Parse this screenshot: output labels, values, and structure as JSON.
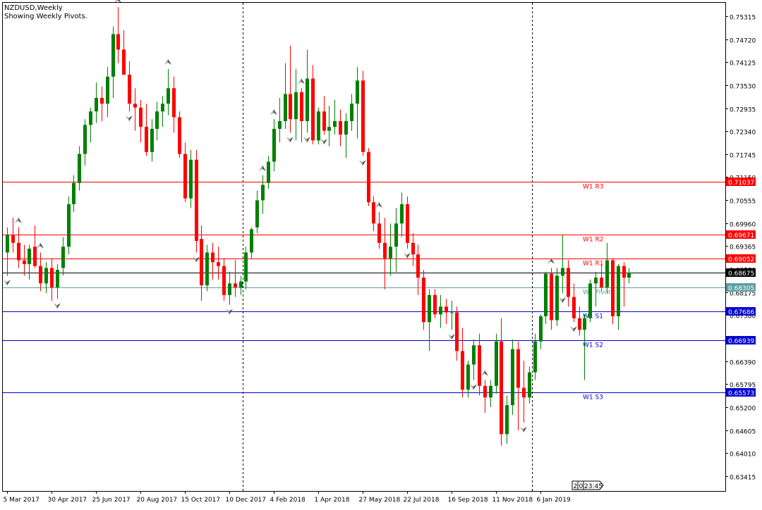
{
  "header": {
    "symbol_line": "NZDUSD,Weekly",
    "subtitle": "Showing Weekly Pivots."
  },
  "timer": {
    "d1": "2",
    "d2": "0",
    "time": "23:45"
  },
  "colors": {
    "bull": "#008000",
    "bear": "#ff0000",
    "grid_border": "#000000",
    "resistance": "#ff0000",
    "support": "#0000cd",
    "pivot": "#5f9ea0",
    "current": "#000000"
  },
  "chart_data": {
    "type": "candlestick",
    "title": "NZDUSD,Weekly",
    "subtitle": "Showing Weekly Pivots.",
    "y_axis": {
      "ticks": [
        "0.75315",
        "0.74720",
        "0.74125",
        "0.73530",
        "0.72935",
        "0.72340",
        "0.71745",
        "0.71150",
        "0.70555",
        "0.69960",
        "0.69365",
        "0.68770",
        "0.68175",
        "0.67580",
        "0.66985",
        "0.66390",
        "0.65795",
        "0.65200",
        "0.64605",
        "0.64010",
        "0.63415"
      ],
      "ylim": [
        0.6303,
        0.7566
      ]
    },
    "x_axis": {
      "labels": [
        {
          "text": "5 Mar 2017",
          "idx": 0
        },
        {
          "text": "30 Apr 2017",
          "idx": 8
        },
        {
          "text": "25 Jun 2017",
          "idx": 16
        },
        {
          "text": "20 Aug 2017",
          "idx": 24
        },
        {
          "text": "15 Oct 2017",
          "idx": 32
        },
        {
          "text": "10 Dec 2017",
          "idx": 40
        },
        {
          "text": "4 Feb 2018",
          "idx": 48
        },
        {
          "text": "1 Apr 2018",
          "idx": 56
        },
        {
          "text": "27 May 2018",
          "idx": 64
        },
        {
          "text": "22 Jul 2018",
          "idx": 72
        },
        {
          "text": "16 Sep 2018",
          "idx": 80
        },
        {
          "text": "11 Nov 2018",
          "idx": 88
        },
        {
          "text": "6 Jan 2019",
          "idx": 96
        }
      ],
      "period_separators": [
        43,
        95
      ]
    },
    "candles": [
      [
        0.692,
        0.6985,
        0.686,
        0.6965
      ],
      [
        0.6965,
        0.701,
        0.692,
        0.6945
      ],
      [
        0.6945,
        0.6985,
        0.688,
        0.69
      ],
      [
        0.69,
        0.694,
        0.686,
        0.689
      ],
      [
        0.689,
        0.694,
        0.685,
        0.693
      ],
      [
        0.6935,
        0.699,
        0.688,
        0.6885
      ],
      [
        0.6885,
        0.692,
        0.682,
        0.684
      ],
      [
        0.684,
        0.6895,
        0.6815,
        0.688
      ],
      [
        0.688,
        0.6905,
        0.6795,
        0.683
      ],
      [
        0.683,
        0.689,
        0.68,
        0.6875
      ],
      [
        0.688,
        0.696,
        0.686,
        0.6935
      ],
      [
        0.6935,
        0.7065,
        0.6915,
        0.7045
      ],
      [
        0.7045,
        0.712,
        0.7025,
        0.71
      ],
      [
        0.71,
        0.7195,
        0.708,
        0.7175
      ],
      [
        0.7175,
        0.7265,
        0.7145,
        0.725
      ],
      [
        0.725,
        0.7295,
        0.7205,
        0.7285
      ],
      [
        0.7285,
        0.736,
        0.7255,
        0.732
      ],
      [
        0.732,
        0.735,
        0.726,
        0.7305
      ],
      [
        0.7305,
        0.74,
        0.727,
        0.7375
      ],
      [
        0.7375,
        0.7505,
        0.732,
        0.7485
      ],
      [
        0.7485,
        0.7555,
        0.741,
        0.7445
      ],
      [
        0.7445,
        0.7495,
        0.738,
        0.738
      ],
      [
        0.738,
        0.7415,
        0.7285,
        0.7305
      ],
      [
        0.7305,
        0.7345,
        0.7235,
        0.7295
      ],
      [
        0.7295,
        0.7315,
        0.7205,
        0.7245
      ],
      [
        0.7245,
        0.7305,
        0.717,
        0.718
      ],
      [
        0.718,
        0.7265,
        0.7155,
        0.724
      ],
      [
        0.724,
        0.731,
        0.721,
        0.7285
      ],
      [
        0.7285,
        0.7325,
        0.7245,
        0.7305
      ],
      [
        0.7305,
        0.7395,
        0.7275,
        0.7345
      ],
      [
        0.7345,
        0.7375,
        0.723,
        0.727
      ],
      [
        0.727,
        0.7285,
        0.7165,
        0.7175
      ],
      [
        0.7175,
        0.7205,
        0.705,
        0.706
      ],
      [
        0.706,
        0.7185,
        0.7035,
        0.716
      ],
      [
        0.716,
        0.7185,
        0.692,
        0.695
      ],
      [
        0.6955,
        0.699,
        0.6795,
        0.6835
      ],
      [
        0.6835,
        0.694,
        0.682,
        0.692
      ],
      [
        0.692,
        0.6945,
        0.685,
        0.6895
      ],
      [
        0.6895,
        0.6935,
        0.685,
        0.6885
      ],
      [
        0.6885,
        0.6905,
        0.6795,
        0.681
      ],
      [
        0.681,
        0.687,
        0.6785,
        0.684
      ],
      [
        0.684,
        0.69,
        0.6805,
        0.683
      ],
      [
        0.683,
        0.686,
        0.681,
        0.6845
      ],
      [
        0.6845,
        0.6935,
        0.6825,
        0.692
      ],
      [
        0.692,
        0.6985,
        0.6905,
        0.698
      ],
      [
        0.6985,
        0.708,
        0.697,
        0.7055
      ],
      [
        0.7055,
        0.712,
        0.702,
        0.7095
      ],
      [
        0.71,
        0.717,
        0.7085,
        0.7155
      ],
      [
        0.7155,
        0.7265,
        0.713,
        0.724
      ],
      [
        0.724,
        0.732,
        0.7205,
        0.726
      ],
      [
        0.726,
        0.741,
        0.724,
        0.733
      ],
      [
        0.733,
        0.7455,
        0.723,
        0.7265
      ],
      [
        0.7265,
        0.7395,
        0.721,
        0.7335
      ],
      [
        0.7335,
        0.7345,
        0.7205,
        0.726
      ],
      [
        0.726,
        0.7445,
        0.723,
        0.737
      ],
      [
        0.737,
        0.7405,
        0.72,
        0.721
      ],
      [
        0.721,
        0.7295,
        0.72,
        0.7285
      ],
      [
        0.7285,
        0.7325,
        0.7225,
        0.7235
      ],
      [
        0.7235,
        0.73,
        0.7195,
        0.7245
      ],
      [
        0.7245,
        0.7315,
        0.7225,
        0.726
      ],
      [
        0.726,
        0.729,
        0.7195,
        0.7225
      ],
      [
        0.7225,
        0.728,
        0.7165,
        0.726
      ],
      [
        0.726,
        0.733,
        0.7235,
        0.7305
      ],
      [
        0.7305,
        0.74,
        0.7215,
        0.7365
      ],
      [
        0.7365,
        0.739,
        0.717,
        0.718
      ],
      [
        0.718,
        0.719,
        0.704,
        0.705
      ],
      [
        0.705,
        0.7065,
        0.6975,
        0.6995
      ],
      [
        0.6995,
        0.7025,
        0.693,
        0.6945
      ],
      [
        0.6945,
        0.701,
        0.6825,
        0.6905
      ],
      [
        0.6905,
        0.6995,
        0.686,
        0.6935
      ],
      [
        0.6935,
        0.7035,
        0.687,
        0.6995
      ],
      [
        0.6995,
        0.7075,
        0.696,
        0.7045
      ],
      [
        0.7045,
        0.7065,
        0.693,
        0.6945
      ],
      [
        0.6945,
        0.697,
        0.6885,
        0.6915
      ],
      [
        0.6915,
        0.694,
        0.681,
        0.6855
      ],
      [
        0.6855,
        0.6875,
        0.672,
        0.674
      ],
      [
        0.674,
        0.6825,
        0.6665,
        0.681
      ],
      [
        0.681,
        0.6825,
        0.675,
        0.676
      ],
      [
        0.676,
        0.681,
        0.6725,
        0.678
      ],
      [
        0.678,
        0.68,
        0.6735,
        0.6765
      ],
      [
        0.6765,
        0.6795,
        0.672,
        0.6765
      ],
      [
        0.6765,
        0.678,
        0.664,
        0.6665
      ],
      [
        0.6665,
        0.6725,
        0.6545,
        0.6565
      ],
      [
        0.6565,
        0.664,
        0.6545,
        0.663
      ],
      [
        0.663,
        0.6695,
        0.659,
        0.668
      ],
      [
        0.668,
        0.671,
        0.655,
        0.6575
      ],
      [
        0.6575,
        0.659,
        0.6505,
        0.6545
      ],
      [
        0.6545,
        0.659,
        0.652,
        0.6575
      ],
      [
        0.6575,
        0.671,
        0.6555,
        0.669
      ],
      [
        0.669,
        0.675,
        0.642,
        0.645
      ],
      [
        0.645,
        0.655,
        0.6425,
        0.6525
      ],
      [
        0.6525,
        0.6695,
        0.65,
        0.667
      ],
      [
        0.667,
        0.669,
        0.646,
        0.657
      ],
      [
        0.657,
        0.664,
        0.648,
        0.6545
      ],
      [
        0.6545,
        0.6625,
        0.653,
        0.661
      ],
      [
        0.661,
        0.671,
        0.659,
        0.669
      ],
      [
        0.669,
        0.676,
        0.667,
        0.6755
      ],
      [
        0.6755,
        0.687,
        0.6735,
        0.6865
      ],
      [
        0.6865,
        0.688,
        0.672,
        0.6745
      ],
      [
        0.6745,
        0.688,
        0.673,
        0.686
      ],
      [
        0.686,
        0.6965,
        0.6815,
        0.688
      ],
      [
        0.688,
        0.69,
        0.678,
        0.6805
      ],
      [
        0.6805,
        0.684,
        0.674,
        0.675
      ],
      [
        0.675,
        0.678,
        0.6705,
        0.672
      ],
      [
        0.672,
        0.676,
        0.659,
        0.675
      ],
      [
        0.675,
        0.685,
        0.674,
        0.684
      ],
      [
        0.684,
        0.687,
        0.678,
        0.6855
      ],
      [
        0.6855,
        0.689,
        0.682,
        0.683
      ],
      [
        0.683,
        0.6945,
        0.6815,
        0.69
      ],
      [
        0.69,
        0.6905,
        0.6735,
        0.6755
      ],
      [
        0.6755,
        0.689,
        0.672,
        0.6885
      ],
      [
        0.6885,
        0.6895,
        0.678,
        0.6855
      ],
      [
        0.6855,
        0.688,
        0.684,
        0.6867
      ]
    ],
    "fractals": {
      "up": [
        2,
        6,
        20,
        29,
        46,
        48,
        53,
        67,
        86,
        98
      ],
      "down": [
        0,
        9,
        22,
        34,
        40,
        51,
        54,
        57,
        64,
        72,
        80,
        84,
        93,
        100,
        102
      ]
    },
    "pivot_lines": [
      {
        "label": "W1 R3",
        "value": 0.71037,
        "tag": "0.71037",
        "kind": "resistance"
      },
      {
        "label": "W1 R2",
        "value": 0.69671,
        "tag": "0.69671",
        "kind": "resistance"
      },
      {
        "label": "W1 R1",
        "value": 0.69052,
        "tag": "0.69052",
        "kind": "resistance"
      },
      {
        "label": "W1 Pivot",
        "value": 0.68305,
        "tag": "0.68305",
        "kind": "pivot"
      },
      {
        "label": "W1 S1",
        "value": 0.67686,
        "tag": "0.67686",
        "kind": "support"
      },
      {
        "label": "W1 S2",
        "value": 0.66939,
        "tag": "0.66939",
        "kind": "support"
      },
      {
        "label": "W1 S3",
        "value": 0.65573,
        "tag": "0.65573",
        "kind": "support"
      }
    ],
    "current_price": {
      "value": 0.68675,
      "tag": "0.68675"
    }
  }
}
